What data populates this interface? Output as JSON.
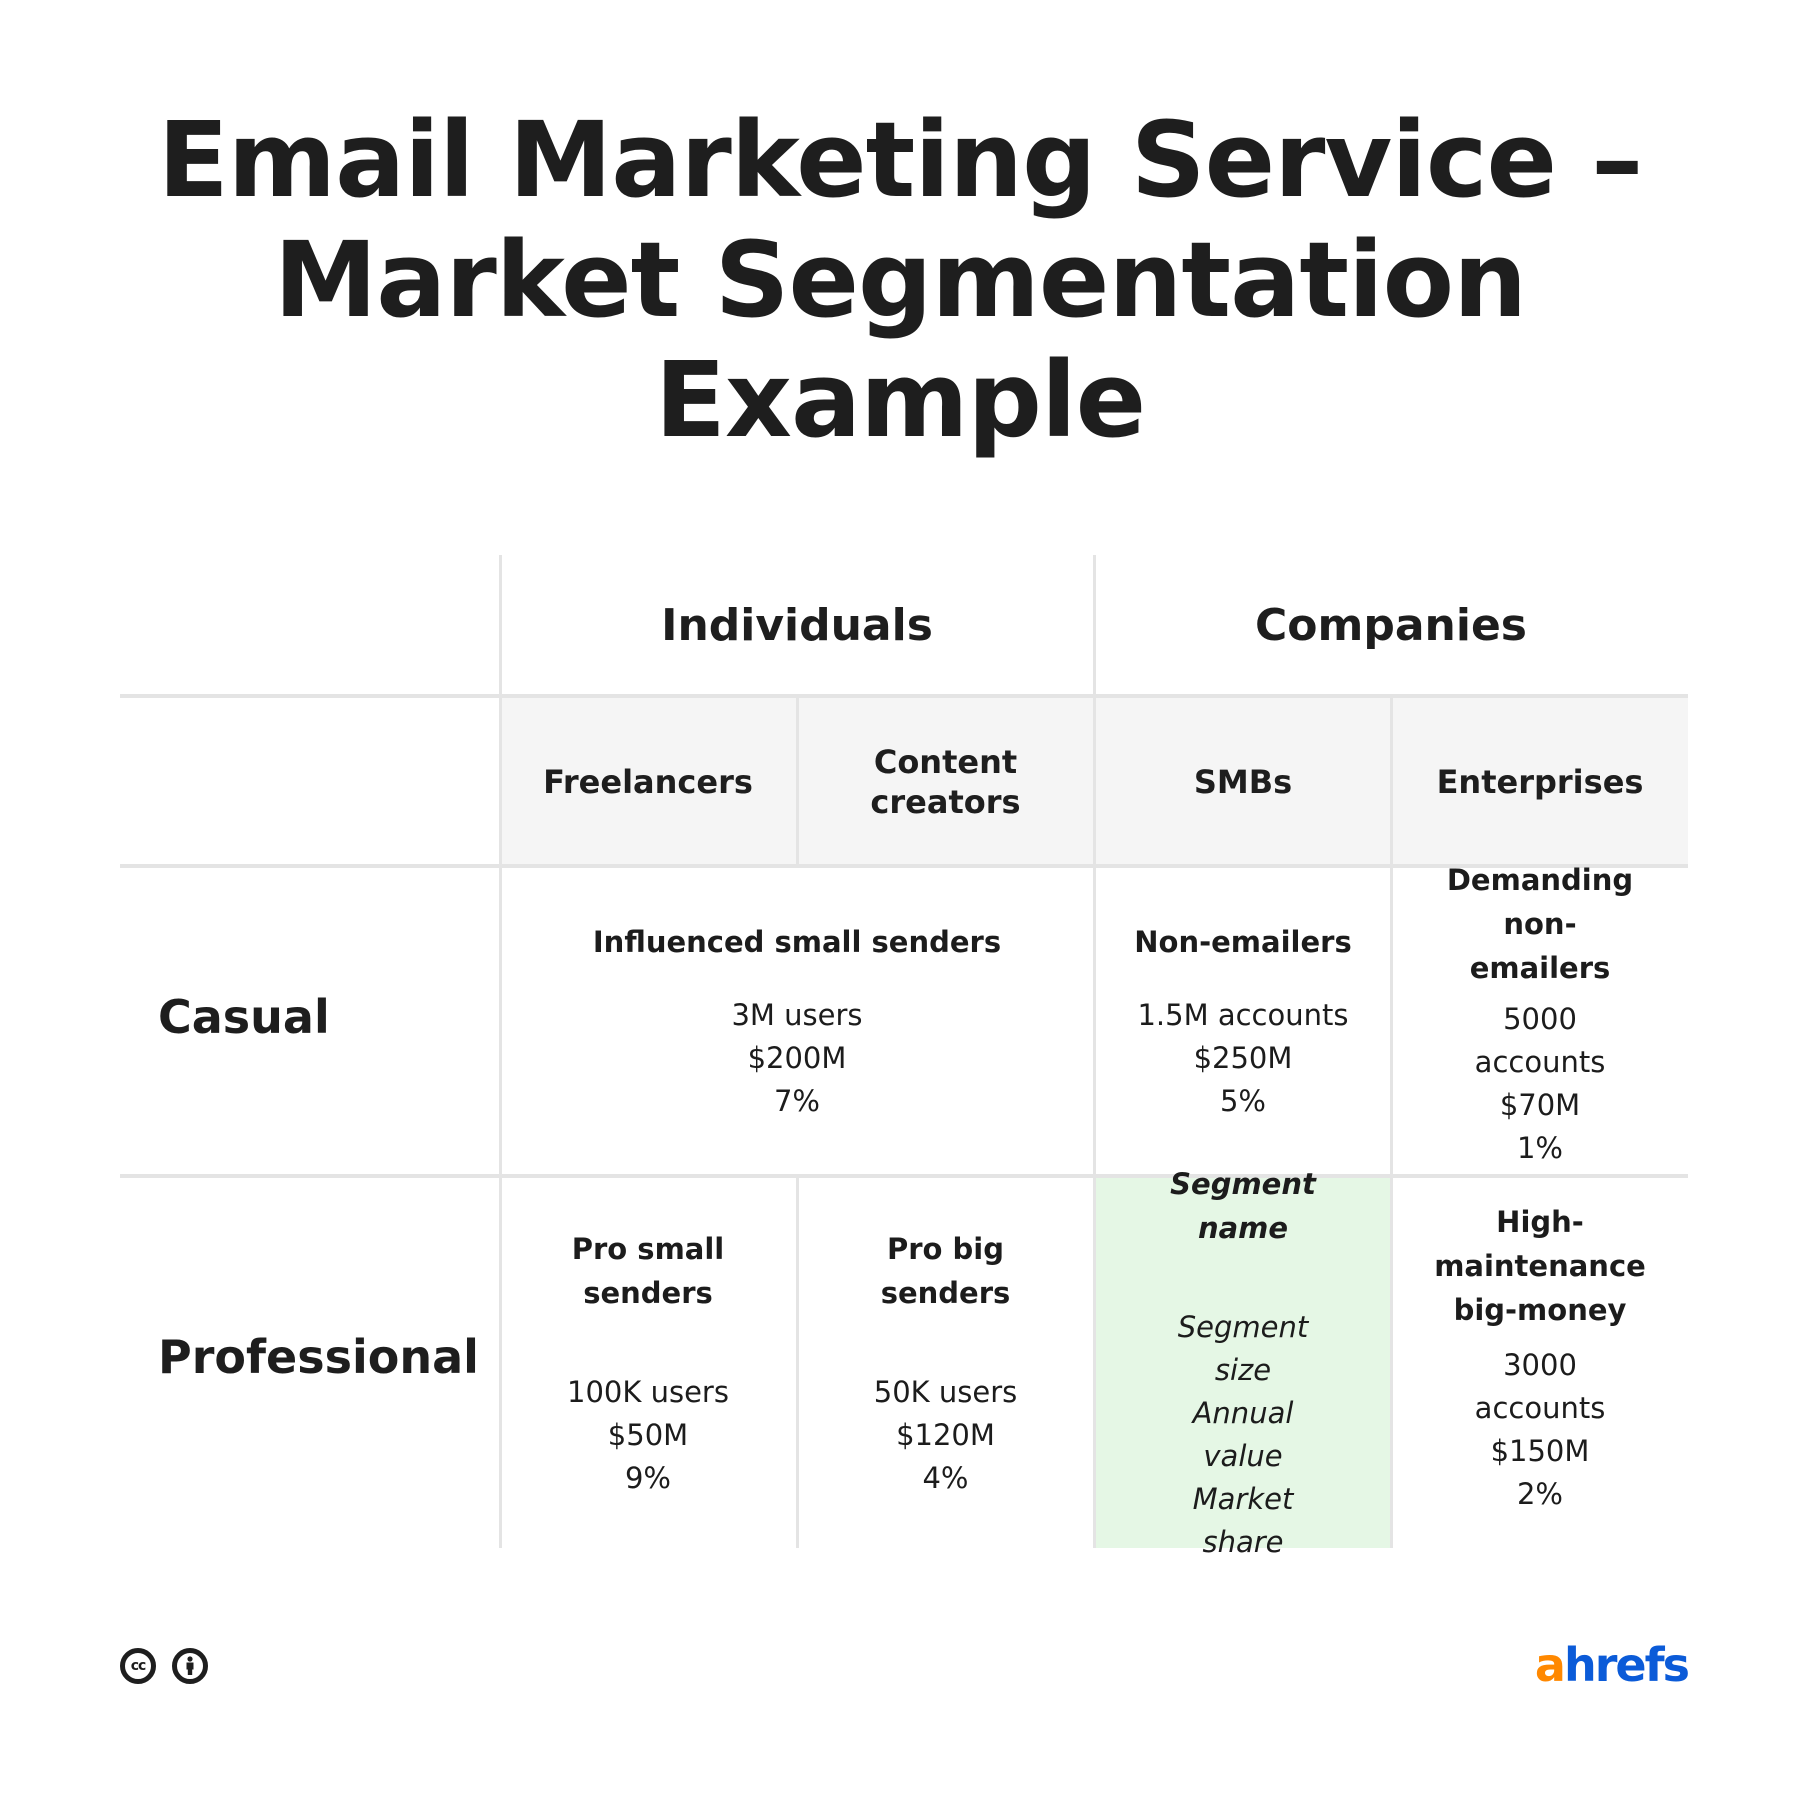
{
  "title": {
    "lines": [
      "Email Marketing Service –",
      "Market Segmentation",
      "Example"
    ]
  },
  "table": {
    "groups": [
      "Individuals",
      "Companies"
    ],
    "subgroups": [
      "Freelancers",
      "Content creators",
      "SMBs",
      "Enterprises"
    ],
    "rows": [
      {
        "label": "Casual",
        "cells": [
          {
            "name": "Influenced small senders",
            "size": "3M users",
            "value": "$200M",
            "share": "7%",
            "span": 2
          },
          {
            "name": "Non-emailers",
            "size": "1.5M accounts",
            "value": "$250M",
            "share": "5%"
          },
          {
            "name": "Demanding non-emailers",
            "size": "5000 accounts",
            "value": "$70M",
            "share": "1%"
          }
        ]
      },
      {
        "label": "Professional",
        "cells": [
          {
            "name": "Pro small senders",
            "size": "100K users",
            "value": "$50M",
            "share": "9%"
          },
          {
            "name": "Pro big senders",
            "size": "50K users",
            "value": "$120M",
            "share": "4%"
          },
          {
            "name": "Segment name",
            "size": "Segment size",
            "value": "Annual value",
            "share": "Market share",
            "highlight": true
          },
          {
            "name": "High-maintenance big-money",
            "size": "3000 accounts",
            "value": "$150M",
            "share": "2%"
          }
        ]
      }
    ]
  },
  "footer": {
    "license_icons": [
      "cc-icon",
      "attribution-icon"
    ],
    "logo": {
      "part1": "a",
      "part2": "hrefs",
      "color1": "#ff8800",
      "color2": "#0b5bd8"
    }
  },
  "colors": {
    "grid": "#e4e4e4",
    "header_bg": "#f5f5f5",
    "highlight_bg": "#e5f7e5",
    "text": "#1e1e1e"
  }
}
